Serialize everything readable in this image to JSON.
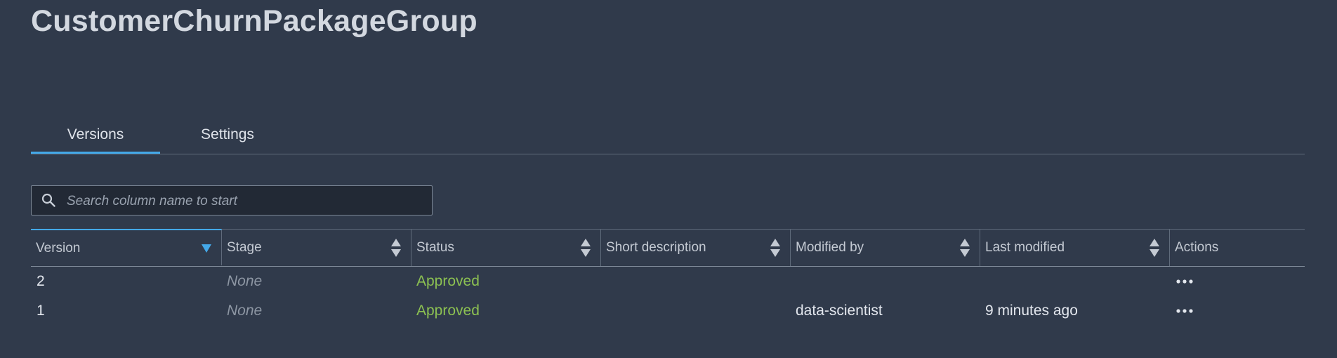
{
  "page": {
    "title": "CustomerChurnPackageGroup"
  },
  "tabs": [
    {
      "label": "Versions",
      "active": true
    },
    {
      "label": "Settings",
      "active": false
    }
  ],
  "search": {
    "placeholder": "Search column name to start",
    "value": "",
    "icon": "search-icon"
  },
  "table": {
    "columns": [
      {
        "label": "Version",
        "sort": "descending"
      },
      {
        "label": "Stage",
        "sort": "none"
      },
      {
        "label": "Status",
        "sort": "none"
      },
      {
        "label": "Short description",
        "sort": "none"
      },
      {
        "label": "Modified by",
        "sort": "none"
      },
      {
        "label": "Last modified",
        "sort": "none"
      },
      {
        "label": "Actions",
        "sort": null
      }
    ],
    "rows": [
      {
        "version": "2",
        "stage": "None",
        "status": "Approved",
        "short_description": "",
        "modified_by": "",
        "last_modified": "",
        "actions_icon": "more-horizontal-icon"
      },
      {
        "version": "1",
        "stage": "None",
        "status": "Approved",
        "short_description": "",
        "modified_by": "data-scientist",
        "last_modified": "9 minutes ago",
        "actions_icon": "more-horizontal-icon"
      }
    ]
  },
  "colors": {
    "background": "#303a4b",
    "accent": "#44a8e8",
    "status_approved": "#8cc152",
    "muted_text": "#8d96a3"
  }
}
